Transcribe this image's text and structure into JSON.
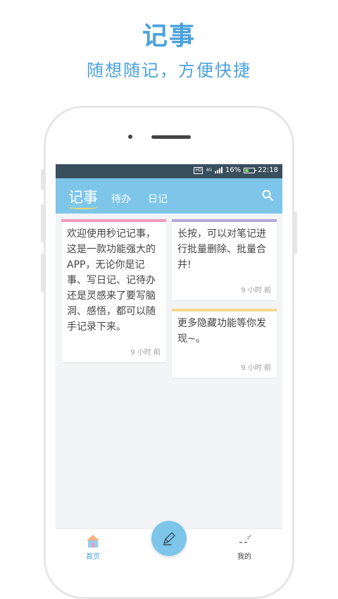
{
  "promo": {
    "title": "记事",
    "subtitle": "随想随记，方便快捷"
  },
  "status_bar": {
    "hd_label": "HD",
    "network_label": "4G",
    "battery_percent": "16%",
    "time": "22:18"
  },
  "app_bar": {
    "tabs": [
      {
        "label": "记事",
        "active": true
      },
      {
        "label": "待办",
        "active": false
      },
      {
        "label": "日记",
        "active": false
      }
    ],
    "search_icon": "search-icon"
  },
  "notes": [
    {
      "text": "欢迎使用秒记记事，这是一款功能强大的APP，无论你是记事、写日记、记待办还是灵感来了要写脑洞、感悟，都可以随手记录下来。",
      "time": "9 小时 前",
      "color": "#f29bbb"
    },
    {
      "text": "长按，可以对笔记进行批量删除、批量合并!",
      "time": "9 小时 前",
      "color": "#b6a8db"
    },
    {
      "text": "更多隐藏功能等你发现~。",
      "time": "9 小时 前",
      "color": "#f3d98e"
    }
  ],
  "bottom_nav": {
    "home_label": "首页",
    "mine_label": "我的",
    "fab_icon": "pencil-icon"
  },
  "colors": {
    "accent": "#7dc6ea",
    "promo_text": "#4aa2dc",
    "status_bar": "#3a4f5e",
    "nav_active": "#4aa2dc"
  }
}
